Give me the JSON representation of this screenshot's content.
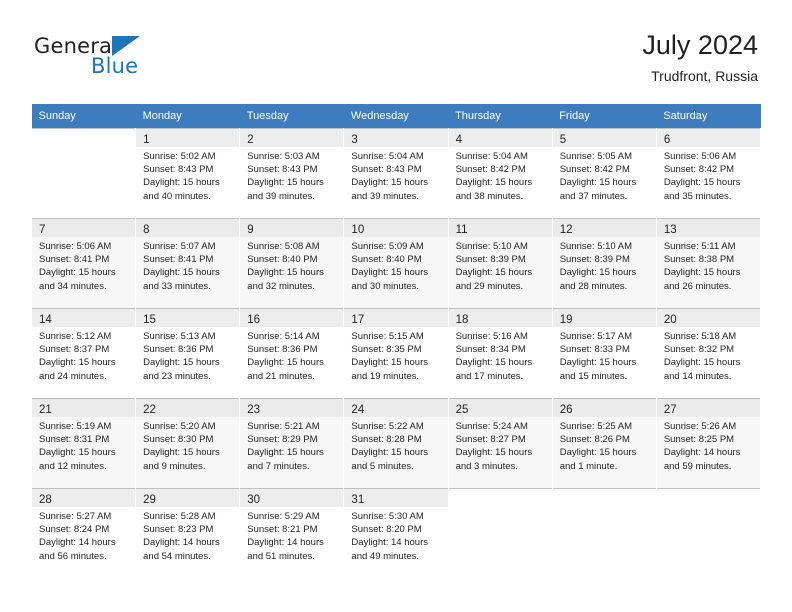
{
  "brand": {
    "name_part1": "General",
    "name_part2": "Blue",
    "triangle_color": "#1b75bb"
  },
  "header": {
    "title": "July 2024",
    "subtitle": "Trudfront, Russia"
  },
  "theme": {
    "header_row_bg": "#3c7cbf",
    "header_row_text": "#ffffff",
    "alt_row_bg": "#f7f7f7",
    "daynum_bg": "#ededed",
    "grid_line": "#bfbfbf"
  },
  "calendar": {
    "weekday_headers": [
      "Sunday",
      "Monday",
      "Tuesday",
      "Wednesday",
      "Thursday",
      "Friday",
      "Saturday"
    ],
    "labels": {
      "sunrise": "Sunrise:",
      "sunset": "Sunset:",
      "daylight": "Daylight:"
    },
    "weeks": [
      [
        {
          "day": "",
          "sunrise": "",
          "sunset": "",
          "daylight_line1": "",
          "daylight_line2": ""
        },
        {
          "day": "1",
          "sunrise": "Sunrise: 5:02 AM",
          "sunset": "Sunset: 8:43 PM",
          "daylight_line1": "Daylight: 15 hours",
          "daylight_line2": "and 40 minutes."
        },
        {
          "day": "2",
          "sunrise": "Sunrise: 5:03 AM",
          "sunset": "Sunset: 8:43 PM",
          "daylight_line1": "Daylight: 15 hours",
          "daylight_line2": "and 39 minutes."
        },
        {
          "day": "3",
          "sunrise": "Sunrise: 5:04 AM",
          "sunset": "Sunset: 8:43 PM",
          "daylight_line1": "Daylight: 15 hours",
          "daylight_line2": "and 39 minutes."
        },
        {
          "day": "4",
          "sunrise": "Sunrise: 5:04 AM",
          "sunset": "Sunset: 8:42 PM",
          "daylight_line1": "Daylight: 15 hours",
          "daylight_line2": "and 38 minutes."
        },
        {
          "day": "5",
          "sunrise": "Sunrise: 5:05 AM",
          "sunset": "Sunset: 8:42 PM",
          "daylight_line1": "Daylight: 15 hours",
          "daylight_line2": "and 37 minutes."
        },
        {
          "day": "6",
          "sunrise": "Sunrise: 5:06 AM",
          "sunset": "Sunset: 8:42 PM",
          "daylight_line1": "Daylight: 15 hours",
          "daylight_line2": "and 35 minutes."
        }
      ],
      [
        {
          "day": "7",
          "sunrise": "Sunrise: 5:06 AM",
          "sunset": "Sunset: 8:41 PM",
          "daylight_line1": "Daylight: 15 hours",
          "daylight_line2": "and 34 minutes."
        },
        {
          "day": "8",
          "sunrise": "Sunrise: 5:07 AM",
          "sunset": "Sunset: 8:41 PM",
          "daylight_line1": "Daylight: 15 hours",
          "daylight_line2": "and 33 minutes."
        },
        {
          "day": "9",
          "sunrise": "Sunrise: 5:08 AM",
          "sunset": "Sunset: 8:40 PM",
          "daylight_line1": "Daylight: 15 hours",
          "daylight_line2": "and 32 minutes."
        },
        {
          "day": "10",
          "sunrise": "Sunrise: 5:09 AM",
          "sunset": "Sunset: 8:40 PM",
          "daylight_line1": "Daylight: 15 hours",
          "daylight_line2": "and 30 minutes."
        },
        {
          "day": "11",
          "sunrise": "Sunrise: 5:10 AM",
          "sunset": "Sunset: 8:39 PM",
          "daylight_line1": "Daylight: 15 hours",
          "daylight_line2": "and 29 minutes."
        },
        {
          "day": "12",
          "sunrise": "Sunrise: 5:10 AM",
          "sunset": "Sunset: 8:39 PM",
          "daylight_line1": "Daylight: 15 hours",
          "daylight_line2": "and 28 minutes."
        },
        {
          "day": "13",
          "sunrise": "Sunrise: 5:11 AM",
          "sunset": "Sunset: 8:38 PM",
          "daylight_line1": "Daylight: 15 hours",
          "daylight_line2": "and 26 minutes."
        }
      ],
      [
        {
          "day": "14",
          "sunrise": "Sunrise: 5:12 AM",
          "sunset": "Sunset: 8:37 PM",
          "daylight_line1": "Daylight: 15 hours",
          "daylight_line2": "and 24 minutes."
        },
        {
          "day": "15",
          "sunrise": "Sunrise: 5:13 AM",
          "sunset": "Sunset: 8:36 PM",
          "daylight_line1": "Daylight: 15 hours",
          "daylight_line2": "and 23 minutes."
        },
        {
          "day": "16",
          "sunrise": "Sunrise: 5:14 AM",
          "sunset": "Sunset: 8:36 PM",
          "daylight_line1": "Daylight: 15 hours",
          "daylight_line2": "and 21 minutes."
        },
        {
          "day": "17",
          "sunrise": "Sunrise: 5:15 AM",
          "sunset": "Sunset: 8:35 PM",
          "daylight_line1": "Daylight: 15 hours",
          "daylight_line2": "and 19 minutes."
        },
        {
          "day": "18",
          "sunrise": "Sunrise: 5:16 AM",
          "sunset": "Sunset: 8:34 PM",
          "daylight_line1": "Daylight: 15 hours",
          "daylight_line2": "and 17 minutes."
        },
        {
          "day": "19",
          "sunrise": "Sunrise: 5:17 AM",
          "sunset": "Sunset: 8:33 PM",
          "daylight_line1": "Daylight: 15 hours",
          "daylight_line2": "and 15 minutes."
        },
        {
          "day": "20",
          "sunrise": "Sunrise: 5:18 AM",
          "sunset": "Sunset: 8:32 PM",
          "daylight_line1": "Daylight: 15 hours",
          "daylight_line2": "and 14 minutes."
        }
      ],
      [
        {
          "day": "21",
          "sunrise": "Sunrise: 5:19 AM",
          "sunset": "Sunset: 8:31 PM",
          "daylight_line1": "Daylight: 15 hours",
          "daylight_line2": "and 12 minutes."
        },
        {
          "day": "22",
          "sunrise": "Sunrise: 5:20 AM",
          "sunset": "Sunset: 8:30 PM",
          "daylight_line1": "Daylight: 15 hours",
          "daylight_line2": "and 9 minutes."
        },
        {
          "day": "23",
          "sunrise": "Sunrise: 5:21 AM",
          "sunset": "Sunset: 8:29 PM",
          "daylight_line1": "Daylight: 15 hours",
          "daylight_line2": "and 7 minutes."
        },
        {
          "day": "24",
          "sunrise": "Sunrise: 5:22 AM",
          "sunset": "Sunset: 8:28 PM",
          "daylight_line1": "Daylight: 15 hours",
          "daylight_line2": "and 5 minutes."
        },
        {
          "day": "25",
          "sunrise": "Sunrise: 5:24 AM",
          "sunset": "Sunset: 8:27 PM",
          "daylight_line1": "Daylight: 15 hours",
          "daylight_line2": "and 3 minutes."
        },
        {
          "day": "26",
          "sunrise": "Sunrise: 5:25 AM",
          "sunset": "Sunset: 8:26 PM",
          "daylight_line1": "Daylight: 15 hours",
          "daylight_line2": "and 1 minute."
        },
        {
          "day": "27",
          "sunrise": "Sunrise: 5:26 AM",
          "sunset": "Sunset: 8:25 PM",
          "daylight_line1": "Daylight: 14 hours",
          "daylight_line2": "and 59 minutes."
        }
      ],
      [
        {
          "day": "28",
          "sunrise": "Sunrise: 5:27 AM",
          "sunset": "Sunset: 8:24 PM",
          "daylight_line1": "Daylight: 14 hours",
          "daylight_line2": "and 56 minutes."
        },
        {
          "day": "29",
          "sunrise": "Sunrise: 5:28 AM",
          "sunset": "Sunset: 8:23 PM",
          "daylight_line1": "Daylight: 14 hours",
          "daylight_line2": "and 54 minutes."
        },
        {
          "day": "30",
          "sunrise": "Sunrise: 5:29 AM",
          "sunset": "Sunset: 8:21 PM",
          "daylight_line1": "Daylight: 14 hours",
          "daylight_line2": "and 51 minutes."
        },
        {
          "day": "31",
          "sunrise": "Sunrise: 5:30 AM",
          "sunset": "Sunset: 8:20 PM",
          "daylight_line1": "Daylight: 14 hours",
          "daylight_line2": "and 49 minutes."
        },
        {
          "day": "",
          "sunrise": "",
          "sunset": "",
          "daylight_line1": "",
          "daylight_line2": ""
        },
        {
          "day": "",
          "sunrise": "",
          "sunset": "",
          "daylight_line1": "",
          "daylight_line2": ""
        },
        {
          "day": "",
          "sunrise": "",
          "sunset": "",
          "daylight_line1": "",
          "daylight_line2": ""
        }
      ]
    ]
  }
}
